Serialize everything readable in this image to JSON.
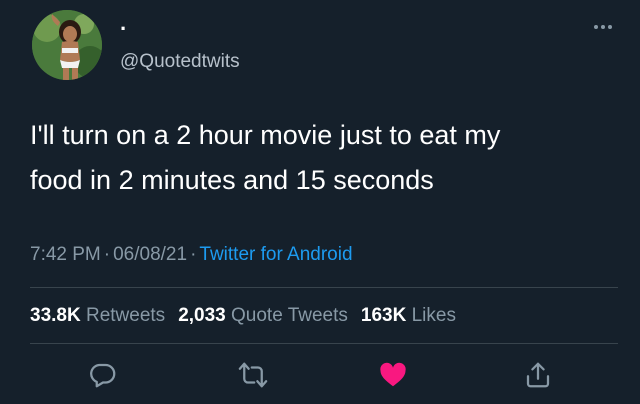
{
  "tweet": {
    "display_name": "·",
    "handle": "@Quotedtwits",
    "text": "I'll turn on a 2 hour movie just to eat my\nfood in 2 minutes and 15 seconds",
    "time": "7:42 PM",
    "date": "06/08/21",
    "source": "Twitter for Android",
    "separator": "·"
  },
  "stats": {
    "retweets_count": "33.8K",
    "retweets_label": "Retweets",
    "quote_count": "2,033",
    "quote_label": "Quote Tweets",
    "likes_count": "163K",
    "likes_label": "Likes"
  },
  "icons": {
    "more": "more-horizontal-icon",
    "reply": "reply-icon",
    "retweet": "retweet-icon",
    "like": "heart-icon",
    "share": "share-icon"
  },
  "colors": {
    "background": "#15202b",
    "link": "#1d9bf0",
    "secondary_text": "#8899a6",
    "like_active": "#f91880",
    "divider": "#38444d"
  }
}
